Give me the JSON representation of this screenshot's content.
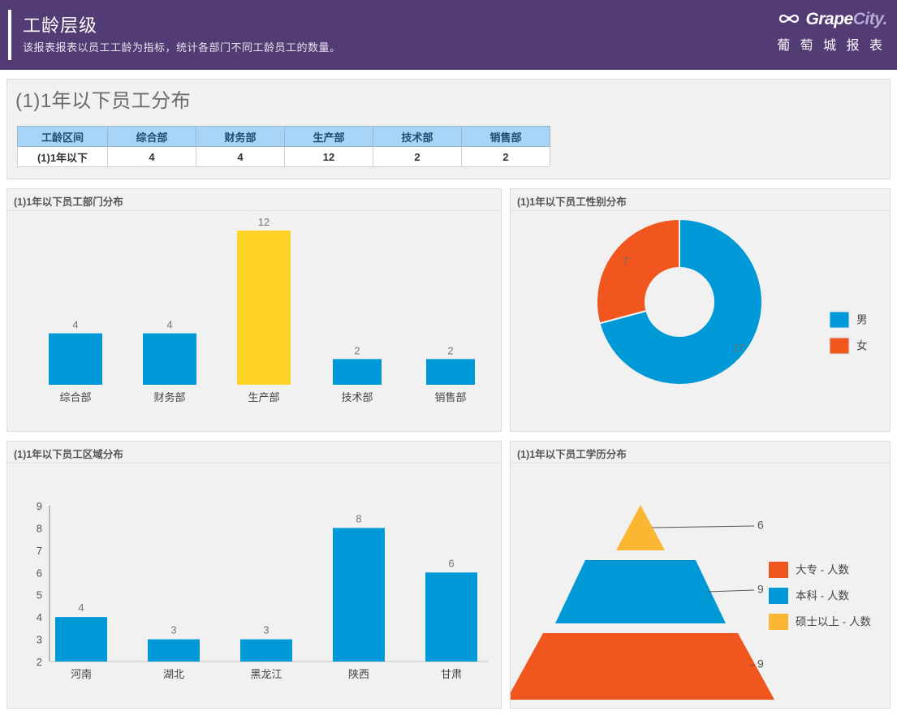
{
  "header": {
    "title": "工龄层级",
    "subtitle": "该报表报表以员工工龄为指标，统计各部门不同工龄员工的数量。",
    "brand_grape": "Grape",
    "brand_city": "City",
    "brand_dot": ".",
    "brand_cn": "葡 萄 城 报 表",
    "bg_color": "#533B74"
  },
  "summary": {
    "section_title": "(1)1年以下员工分布",
    "table": {
      "headers": [
        "工龄区间",
        "综合部",
        "财务部",
        "生产部",
        "技术部",
        "销售部"
      ],
      "rows": [
        [
          "(1)1年以下",
          "4",
          "4",
          "12",
          "2",
          "2"
        ]
      ]
    }
  },
  "panels": {
    "dept": {
      "title": "(1)1年以下员工部门分布"
    },
    "gender": {
      "title": "(1)1年以下员工性别分布"
    },
    "region": {
      "title": "(1)1年以下员工区域分布"
    },
    "edu": {
      "title": "(1)1年以下员工学历分布"
    }
  },
  "colors": {
    "blue": "#0099D8",
    "yellow": "#FFD427",
    "amber": "#FBB731",
    "orange": "#F0561E",
    "purple": "#533B74",
    "panel_bg": "#f1f1f1",
    "table_header": "#a8d5f7"
  },
  "chart_data": [
    {
      "type": "bar",
      "id": "dept-distribution",
      "title": "(1)1年以下员工部门分布",
      "categories": [
        "综合部",
        "财务部",
        "生产部",
        "技术部",
        "销售部"
      ],
      "values": [
        4,
        4,
        12,
        2,
        2
      ],
      "labels": [
        "4",
        "4",
        "12",
        "2",
        "2"
      ],
      "colors": [
        "#0099D8",
        "#0099D8",
        "#FFD427",
        "#0099D8",
        "#0099D8"
      ],
      "xlabel": "",
      "ylabel": "",
      "axis_visible": false,
      "grid": false
    },
    {
      "type": "pie",
      "id": "gender-distribution",
      "title": "(1)1年以下员工性别分布",
      "donut": true,
      "categories": [
        "男",
        "女"
      ],
      "values": [
        17,
        7
      ],
      "labels": [
        "17",
        "7"
      ],
      "colors": [
        "#0099D8",
        "#F0561E"
      ],
      "legend": [
        "男",
        "女"
      ],
      "legend_position": "right"
    },
    {
      "type": "bar",
      "id": "region-distribution",
      "title": "(1)1年以下员工区域分布",
      "categories": [
        "河南",
        "湖北",
        "黑龙江",
        "陕西",
        "甘肃"
      ],
      "values": [
        4,
        3,
        3,
        8,
        6
      ],
      "labels": [
        "4",
        "3",
        "3",
        "8",
        "6"
      ],
      "colors": [
        "#0099D8",
        "#0099D8",
        "#0099D8",
        "#0099D8",
        "#0099D8"
      ],
      "ylim": [
        2,
        9
      ],
      "yticks": [
        "9",
        "8",
        "7",
        "6",
        "5",
        "4",
        "3",
        "2"
      ],
      "xlabel": "",
      "ylabel": "",
      "grid": false
    },
    {
      "type": "pie",
      "id": "education-distribution",
      "title": "(1)1年以下员工学历分布",
      "shape": "pyramid",
      "categories": [
        "大专 - 人数",
        "本科 - 人数",
        "硕士以上 - 人数"
      ],
      "values": [
        9,
        9,
        6
      ],
      "labels": [
        "9",
        "9",
        "6"
      ],
      "colors": [
        "#F0561E",
        "#0099D8",
        "#FBB731"
      ],
      "legend": [
        "大专 - 人数",
        "本科 - 人数",
        "硕士以上 - 人数"
      ],
      "legend_position": "right"
    }
  ]
}
